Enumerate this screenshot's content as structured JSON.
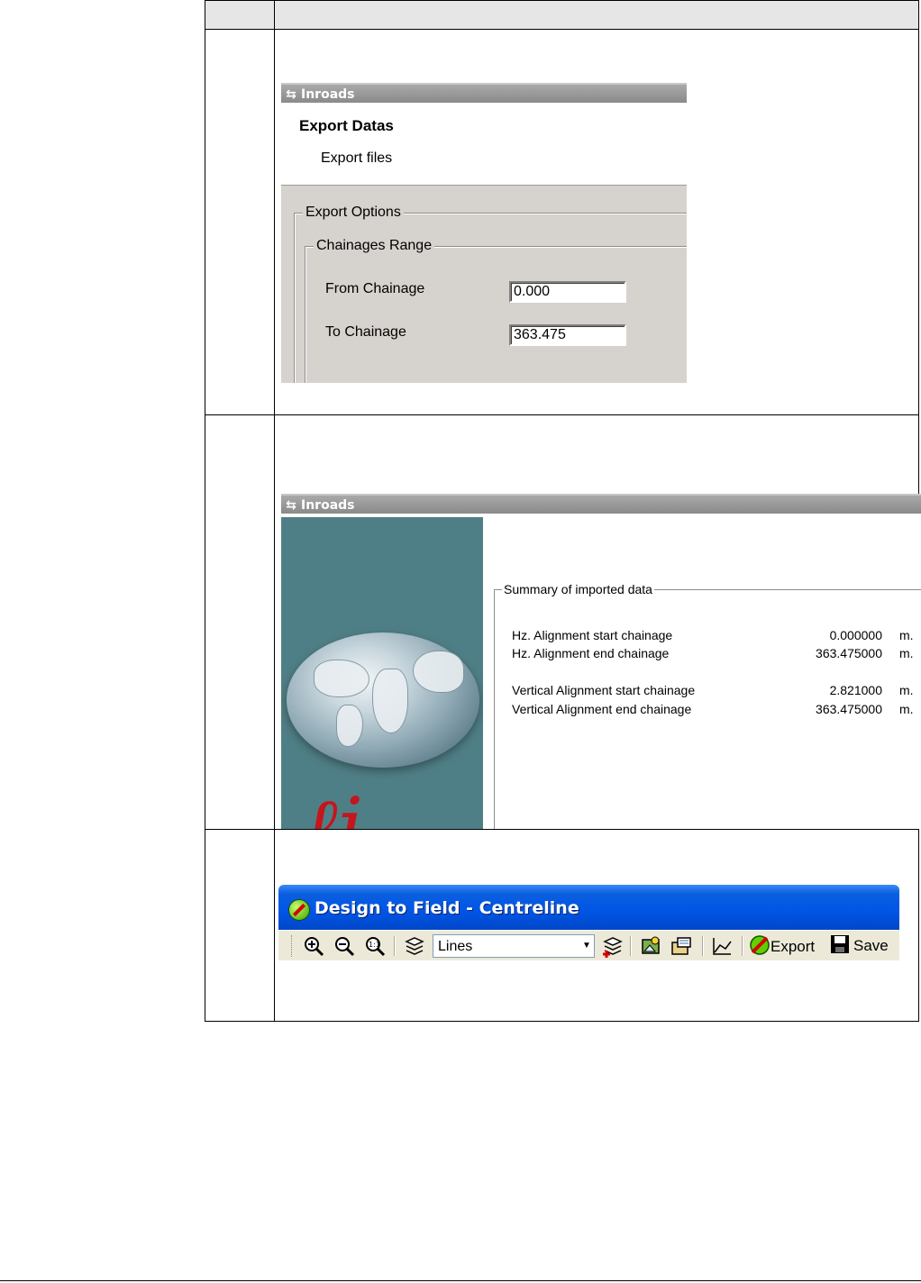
{
  "screen1": {
    "window_title": "Inroads",
    "heading": "Export Datas",
    "subheading": "Export files",
    "group_outer": "Export Options",
    "group_inner": "Chainages Range",
    "from_label": "From Chainage",
    "from_value": "0.000",
    "to_label": "To Chainage",
    "to_value": "363.475"
  },
  "screen2": {
    "window_title": "Inroads",
    "group_title": "Summary of imported data",
    "rows": [
      {
        "label": "Hz. Alignment start chainage",
        "value": "0.000000",
        "unit": "m."
      },
      {
        "label": "Hz. Alignment end chainage",
        "value": "363.475000",
        "unit": "m."
      },
      {
        "label": "Vertical Alignment start chainage",
        "value": "2.821000",
        "unit": "m."
      },
      {
        "label": "Vertical Alignment end chainage",
        "value": "363.475000",
        "unit": "m."
      }
    ]
  },
  "screen3": {
    "window_title": "Design to Field - Centreline",
    "layer_select": "Lines",
    "export_label": "Export",
    "save_label": "Save"
  },
  "colors": {
    "xp_title_blue": "#0055e5",
    "classic_face": "#d6d3ce",
    "globe_panel": "#4f7f86",
    "logo_red": "#c4161c"
  }
}
